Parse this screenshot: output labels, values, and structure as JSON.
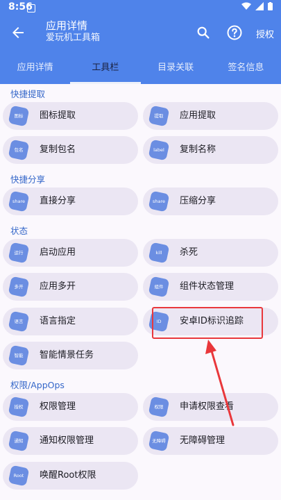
{
  "status_bar": {
    "time": "8:56"
  },
  "toolbar": {
    "title": "应用详情",
    "subtitle": "爱玩机工具箱",
    "auth_label": "授权"
  },
  "tabs": [
    {
      "label": "应用详情"
    },
    {
      "label": "工具栏"
    },
    {
      "label": "目录关联"
    },
    {
      "label": "签名信息"
    }
  ],
  "sections": {
    "quick_extract": "快捷提取",
    "quick_share": "快捷分享",
    "state": "状态",
    "permissions": "权限/AppOps"
  },
  "items": [
    {
      "label": "图标提取",
      "icon_text": "图标"
    },
    {
      "label": "应用提取",
      "icon_text": "提取"
    },
    {
      "label": "复制包名",
      "icon_text": "包名"
    },
    {
      "label": "复制名称",
      "icon_text": "label"
    },
    {
      "label": "直接分享",
      "icon_text": "share"
    },
    {
      "label": "压缩分享",
      "icon_text": "share"
    },
    {
      "label": "启动应用",
      "icon_text": "运行"
    },
    {
      "label": "杀死",
      "icon_text": "kill"
    },
    {
      "label": "应用多开",
      "icon_text": "多开"
    },
    {
      "label": "组件状态管理",
      "icon_text": "组件"
    },
    {
      "label": "语言指定",
      "icon_text": "语言"
    },
    {
      "label": "安卓ID标识追踪",
      "icon_text": "ID"
    },
    {
      "label": "智能情景任务",
      "icon_text": "智能"
    },
    {
      "label": "权限管理",
      "icon_text": "授权"
    },
    {
      "label": "申请权限查看",
      "icon_text": "权限"
    },
    {
      "label": "通知权限管理",
      "icon_text": "通知"
    },
    {
      "label": "无障碍管理",
      "icon_text": "无障碍"
    },
    {
      "label": "唤醒Root权限",
      "icon_text": "Root"
    }
  ],
  "colors": {
    "header": "#4f83ea",
    "accent": "#3567c9",
    "highlight": "#e9373b",
    "item_bg": "#ebe6f3"
  }
}
